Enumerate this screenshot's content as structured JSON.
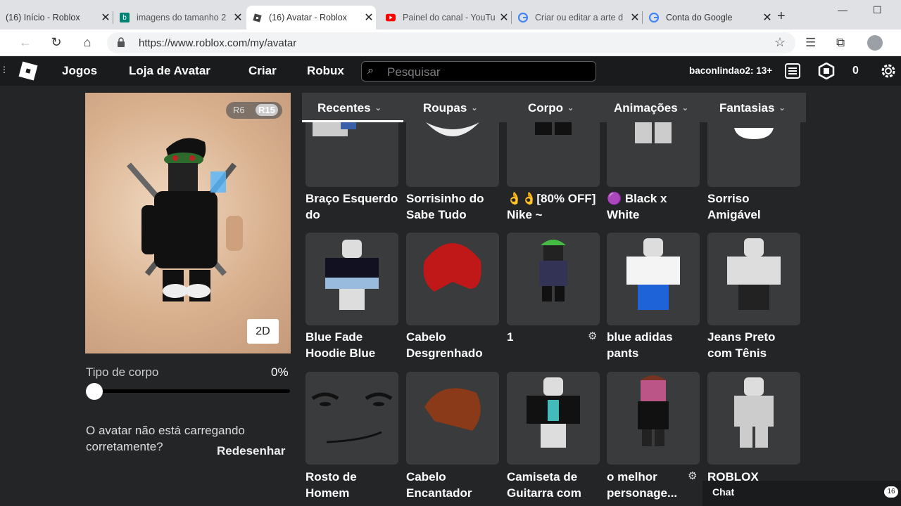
{
  "browser": {
    "tabs": [
      {
        "title": "(16) Início - Roblox",
        "icon": "roblox-icon"
      },
      {
        "title": "imagens do tamanho 2",
        "icon": "bing-icon"
      },
      {
        "title": "(16) Avatar - Roblox",
        "icon": "roblox-icon"
      },
      {
        "title": "Painel do canal - YouTu",
        "icon": "youtube-icon"
      },
      {
        "title": "Criar ou editar a arte d",
        "icon": "google-icon"
      },
      {
        "title": "Conta do Google",
        "icon": "google-icon"
      }
    ],
    "url": "https://www.roblox.com/my/avatar",
    "colors": {
      "tabstrip": "#dfe1e5",
      "youtube": "#ff0000"
    }
  },
  "header": {
    "nav": [
      "Jogos",
      "Loja de Avatar",
      "Criar",
      "Robux"
    ],
    "search_placeholder": "Pesquisar",
    "username": "baconlindao2: 13+",
    "robux": "0"
  },
  "avatar": {
    "rig_options": [
      "R6",
      "R15"
    ],
    "rig_selected": "R15",
    "view_button": "2D",
    "body_type_label": "Tipo de corpo",
    "body_type_value": "0%",
    "body_type_fraction": 0,
    "loading_msg": "O avatar não está carregando corretamente?",
    "redraw": "Redesenhar"
  },
  "categories": [
    {
      "label": "Recentes",
      "selected": true
    },
    {
      "label": "Roupas"
    },
    {
      "label": "Corpo"
    },
    {
      "label": "Animações"
    },
    {
      "label": "Fantasias"
    }
  ],
  "items": [
    {
      "name": "Braço Esquerdo do",
      "thumb": "left-arm"
    },
    {
      "name": "Sorrisinho do Sabe Tudo",
      "thumb": "smile-face"
    },
    {
      "name": "👌👌[80% OFF] Nike ~",
      "thumb": "pants"
    },
    {
      "name": "🟣 Black x White",
      "thumb": "pants-bw"
    },
    {
      "name": "Sorriso Amigável",
      "thumb": "friendly-face"
    },
    {
      "name": "Blue Fade Hoodie Blue",
      "thumb": "hoodie"
    },
    {
      "name": "Cabelo Desgrenhado",
      "thumb": "red-hair"
    },
    {
      "name": "1",
      "thumb": "outfit",
      "gear": true
    },
    {
      "name": "blue adidas pants",
      "thumb": "blue-pants"
    },
    {
      "name": "Jeans Preto com Tênis",
      "thumb": "jeans"
    },
    {
      "name": "Rosto de Homem",
      "thumb": "man-face"
    },
    {
      "name": "Cabelo Encantador",
      "thumb": "brown-hair"
    },
    {
      "name": "Camiseta de Guitarra com",
      "thumb": "guitar-shirt"
    },
    {
      "name": "o melhor personage...",
      "thumb": "character",
      "gear": true
    },
    {
      "name": "ROBLOX",
      "thumb": "white-body"
    }
  ],
  "chat": {
    "label": "Chat",
    "badge": "16"
  }
}
